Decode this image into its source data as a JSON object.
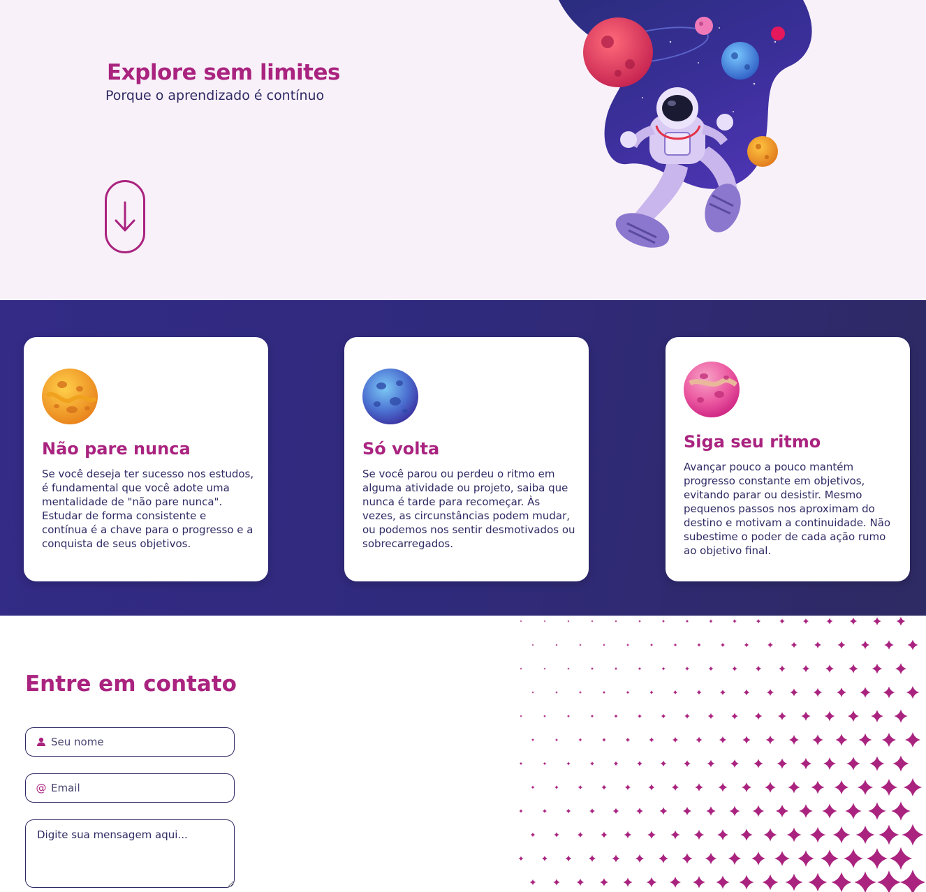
{
  "hero": {
    "title": "Explore sem limites",
    "subtitle": "Porque o aprendizado é contínuo",
    "scroll_icon": "arrow-down-icon",
    "illustration": "astronaut-in-space-illustration"
  },
  "cards": [
    {
      "icon": "orange-planet-icon",
      "title": "Não pare nunca",
      "text": "Se você deseja ter sucesso nos estudos, é fundamental que você adote uma mentalidade de \"não pare nunca\". Estudar de forma consistente e contínua é a chave para o progresso e a conquista de seus objetivos."
    },
    {
      "icon": "blue-planet-icon",
      "title": "Só volta",
      "text": "Se você parou ou perdeu o ritmo em alguma atividade ou projeto, saiba que nunca é tarde para recomeçar. Às vezes, as circunstâncias podem mudar, ou podemos nos sentir desmotivados ou sobrecarregados."
    },
    {
      "icon": "pink-planet-icon",
      "title": "Siga seu ritmo",
      "text": "Avançar pouco a pouco mantém progresso constante em objetivos, evitando parar ou desistir. Mesmo pequenos passos nos aproximam do destino e motivam a continuidade. Não subestime o poder de cada ação rumo ao objetivo final."
    }
  ],
  "contact": {
    "title": "Entre em contato",
    "name_placeholder": "Seu nome",
    "name_icon": "user-icon",
    "email_placeholder": "Email",
    "email_icon": "at-icon",
    "message_placeholder": "Digite sua mensagem aqui..."
  },
  "colors": {
    "accent": "#a9237f",
    "dark_navy": "#2e2a63",
    "indigo": "#332b86",
    "hero_bg": "#f9f1f9"
  }
}
